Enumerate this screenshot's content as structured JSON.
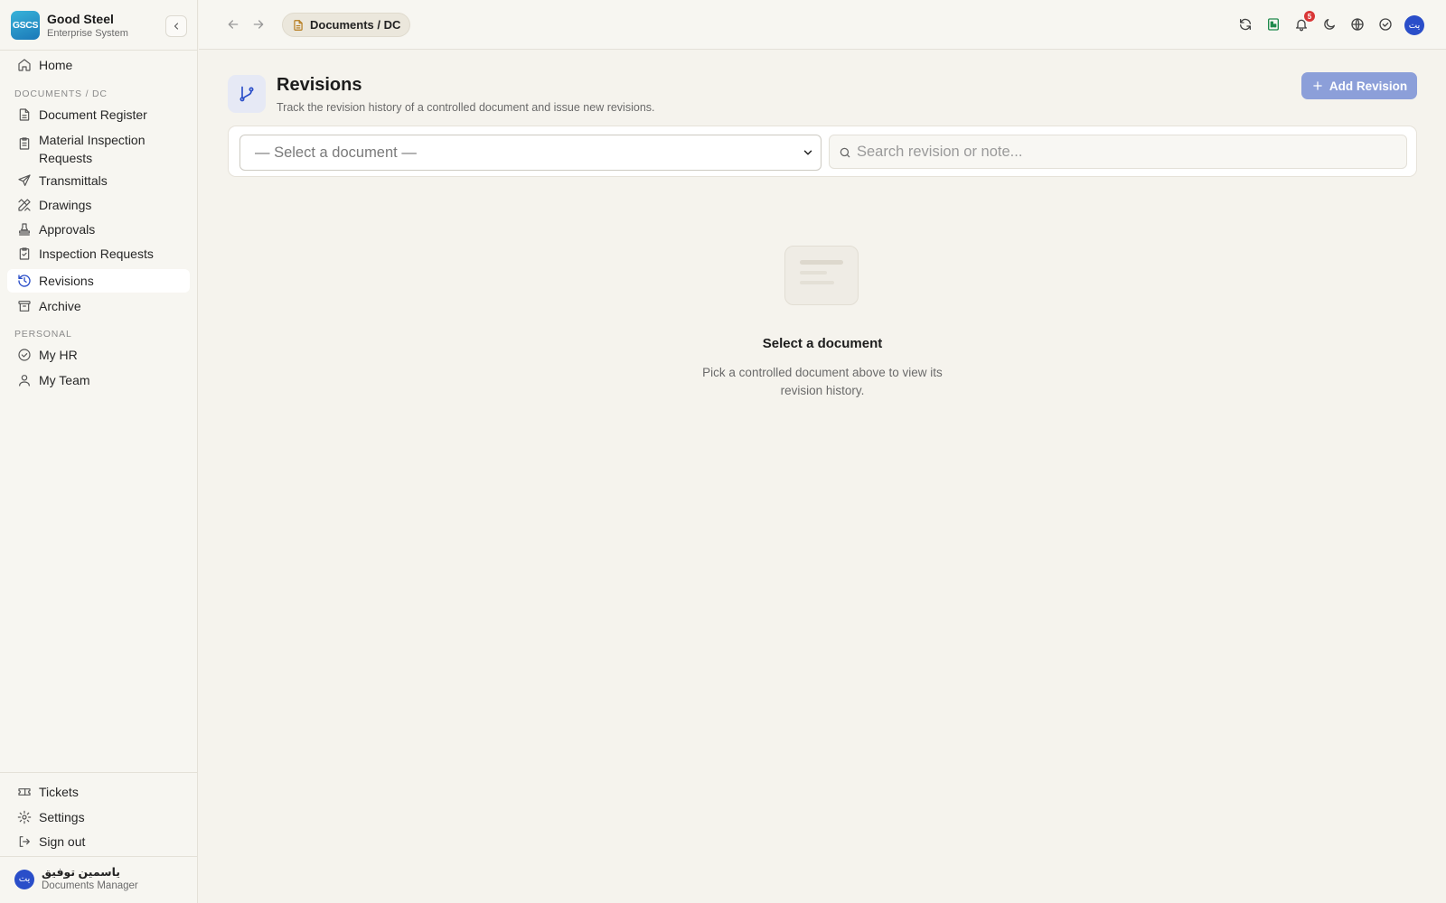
{
  "brand": {
    "logo_text": "GSCS",
    "name": "Good Steel",
    "subtitle": "Enterprise System"
  },
  "sidebar": {
    "home": "Home",
    "section_documents": "DOCUMENTS / DC",
    "doc_items": [
      {
        "label": "Document Register",
        "icon": "file-text-icon"
      },
      {
        "label": "Material Inspection Requests",
        "icon": "clipboard-icon"
      },
      {
        "label": "Transmittals",
        "icon": "send-icon"
      },
      {
        "label": "Drawings",
        "icon": "ruler-pencil-icon"
      },
      {
        "label": "Approvals",
        "icon": "stamp-icon"
      },
      {
        "label": "Inspection Requests",
        "icon": "clipboard-check-icon"
      },
      {
        "label": "Revisions",
        "icon": "history-icon",
        "active": true
      },
      {
        "label": "Archive",
        "icon": "archive-icon"
      }
    ],
    "section_personal": "PERSONAL",
    "personal_items": [
      {
        "label": "My HR",
        "icon": "circle-check-icon"
      },
      {
        "label": "My Team",
        "icon": "user-icon"
      }
    ],
    "bottom_items": [
      {
        "label": "Tickets",
        "icon": "ticket-icon"
      },
      {
        "label": "Settings",
        "icon": "gear-icon"
      },
      {
        "label": "Sign out",
        "icon": "sign-out-icon"
      }
    ],
    "user": {
      "avatar": "يت",
      "name": "ياسمين توفيق",
      "role": "Documents Manager"
    }
  },
  "topbar": {
    "breadcrumb": "Documents / DC",
    "notifications_count": "5",
    "avatar": "يت"
  },
  "main": {
    "title": "Revisions",
    "subtitle": "Track the revision history of a controlled document and issue new revisions.",
    "add_button": "Add Revision",
    "select_placeholder": "— Select a document —",
    "search_placeholder": "Search revision or note...",
    "empty_title": "Select a document",
    "empty_desc": "Pick a controlled document above to view its revision history."
  },
  "colors": {
    "accent": "#2a4ec9",
    "add_button": "#8c9fd9",
    "badge": "#d93636"
  }
}
